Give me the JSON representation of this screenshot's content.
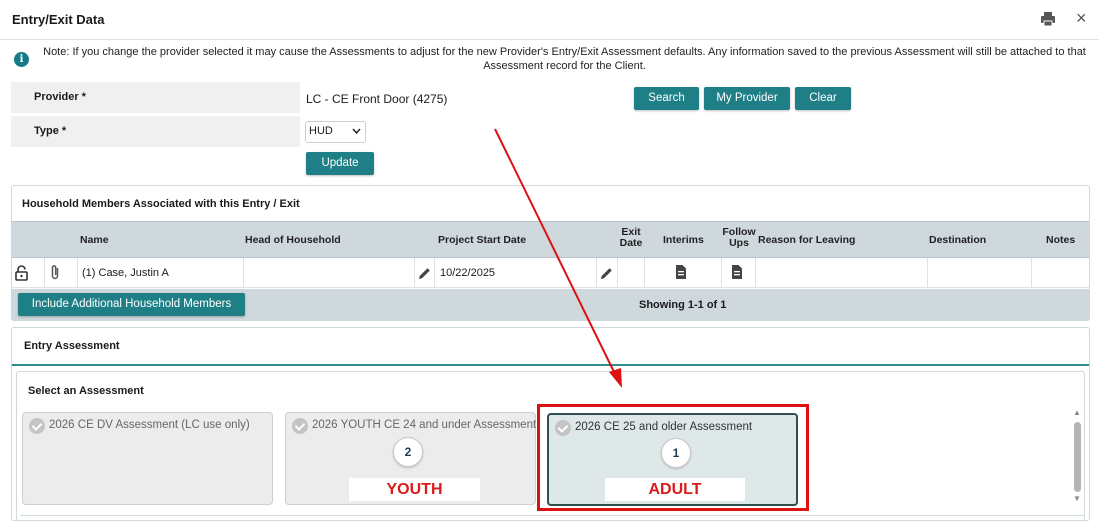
{
  "window": {
    "title": "Entry/Exit Data",
    "print_icon": "print-icon",
    "close_glyph": "×"
  },
  "note": {
    "icon_glyph": "i",
    "text": "Note: If you change the provider selected it may cause the Assessments to adjust for the new Provider's Entry/Exit Assessment defaults. Any information saved to the previous Assessment will still be attached to that Assessment record for the Client."
  },
  "form": {
    "provider_label": "Provider *",
    "provider_value": "LC - CE Front Door (4275)",
    "type_label": "Type *",
    "type_value": "HUD",
    "search_label": "Search",
    "my_provider_label": "My Provider",
    "clear_label": "Clear",
    "update_label": "Update"
  },
  "household": {
    "title": "Household Members Associated with this Entry / Exit",
    "columns": {
      "name": "Name",
      "head_of_household": "Head of Household",
      "project_start_date": "Project Start Date",
      "exit_date": "Exit Date",
      "interims": "Interims",
      "follow_ups": "Follow Ups",
      "reason_for_leaving": "Reason for Leaving",
      "destination": "Destination",
      "notes": "Notes"
    },
    "rows": [
      {
        "name": "(1) Case, Justin A",
        "project_start_date": "10/22/2025"
      }
    ],
    "include_button_label": "Include Additional Household Members",
    "showing_text": "Showing 1-1 of 1"
  },
  "entry_assessment": {
    "title": "Entry Assessment",
    "select_title": "Select an Assessment",
    "cards": [
      {
        "label": "2026 CE DV Assessment (LC use only)"
      },
      {
        "label": "2026 YOUTH CE 24 and under Assessment",
        "badge": "2",
        "tag": "YOUTH"
      },
      {
        "label": "2026 CE 25 and older Assessment",
        "badge": "1",
        "tag": "ADULT",
        "selected": true
      }
    ]
  },
  "colors": {
    "accent": "#1f7f86",
    "highlight": "#dd1111",
    "header_gray": "#cfd8dd"
  }
}
